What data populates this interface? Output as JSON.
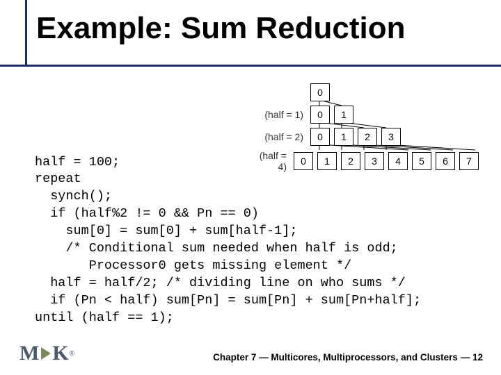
{
  "title": "Example: Sum Reduction",
  "diagram": {
    "rows": [
      {
        "label": "",
        "cells": [
          "0"
        ]
      },
      {
        "label": "(half = 1)",
        "cells": [
          "0",
          "1"
        ]
      },
      {
        "label": "(half = 2)",
        "cells": [
          "0",
          "1",
          "2",
          "3"
        ]
      },
      {
        "label": "(half = 4)",
        "cells": [
          "0",
          "1",
          "2",
          "3",
          "4",
          "5",
          "6",
          "7"
        ]
      }
    ]
  },
  "code_lines": [
    "half = 100;",
    "repeat",
    "  synch();",
    "  if (half%2 != 0 && Pn == 0)",
    "    sum[0] = sum[0] + sum[half-1];",
    "    /* Conditional sum needed when half is odd;",
    "       Processor0 gets missing element */",
    "  half = half/2; /* dividing line on who sums */",
    "  if (Pn < half) sum[Pn] = sum[Pn] + sum[Pn+half];",
    "until (half == 1);"
  ],
  "footer": {
    "chapter": "Chapter 7",
    "topic": "Multicores, Multiprocessors, and Clusters",
    "page": "12"
  },
  "logo_text": "M",
  "logo_text2": "K"
}
